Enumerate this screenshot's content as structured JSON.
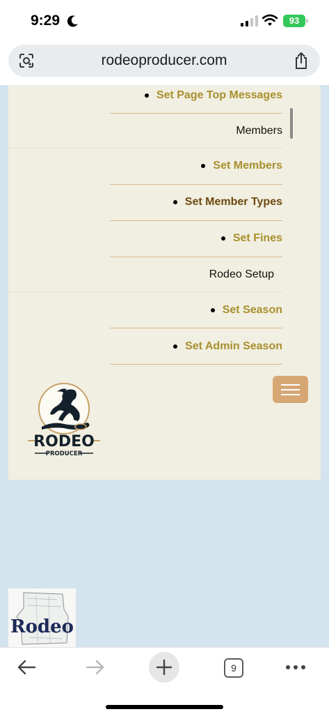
{
  "status_bar": {
    "time": "9:29",
    "battery": "93"
  },
  "browser": {
    "url": "rodeoproducer.com",
    "tab_count": "9"
  },
  "menu": {
    "items": [
      {
        "label": "Set Page Top Messages",
        "kind": "link"
      },
      {
        "label": "Members",
        "kind": "heading"
      },
      {
        "label": "Set Members",
        "kind": "link"
      },
      {
        "label": "Set Member Types",
        "kind": "link-visited"
      },
      {
        "label": "Set Fines",
        "kind": "link"
      },
      {
        "label": "Rodeo Setup",
        "kind": "heading"
      },
      {
        "label": "Set Season",
        "kind": "link"
      },
      {
        "label": "Set Admin Season",
        "kind": "link"
      }
    ]
  },
  "logo": {
    "word": "RODEO",
    "subword": "PRODUCER"
  },
  "thumbnail": {
    "word": "Rodeo"
  },
  "colors": {
    "page_background": "#d3e4ef",
    "menu_background": "#f1efe1",
    "link": "#a88f2e",
    "link_visited": "#6e4a10",
    "separator": "#d6b98a",
    "hamburger": "#d6a774",
    "battery": "#34c759"
  },
  "icons": {
    "moon": "moon-icon",
    "signal": "signal-icon",
    "wifi": "wifi-icon",
    "lens": "lens-icon",
    "share": "share-icon",
    "menu": "hamburger-icon",
    "back": "back-arrow-icon",
    "forward": "forward-arrow-icon",
    "new_tab": "plus-icon",
    "more": "more-icon"
  }
}
